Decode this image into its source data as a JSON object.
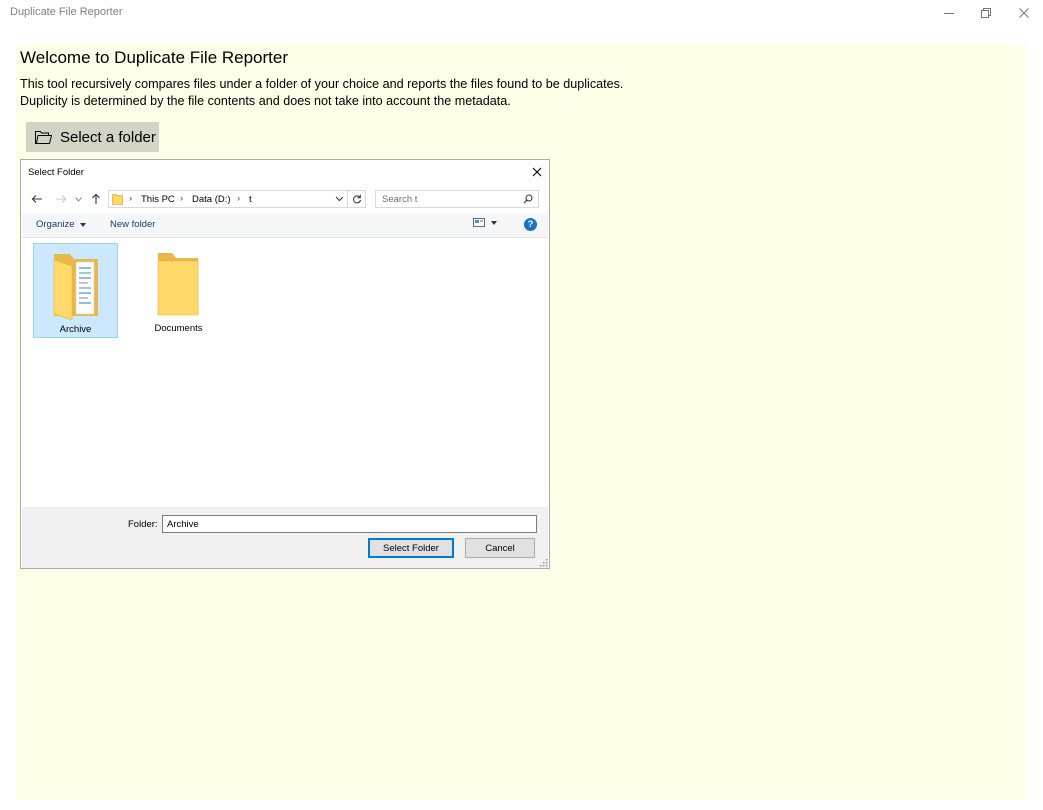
{
  "window": {
    "title": "Duplicate File Reporter"
  },
  "main": {
    "heading": "Welcome to Duplicate File Reporter",
    "description_line1": "This tool recursively compares files under a folder of your choice and reports the files found to be duplicates.",
    "description_line2": "Duplicity is determined by the file contents and does not take into account the metadata.",
    "select_button": "Select a folder"
  },
  "dialog": {
    "title": "Select Folder",
    "breadcrumbs": [
      "This PC",
      "Data (D:)",
      "t"
    ],
    "search_placeholder": "Search t",
    "organize_label": "Organize",
    "new_folder_label": "New folder",
    "help_label": "?",
    "items": [
      {
        "name": "Archive",
        "selected": true
      },
      {
        "name": "Documents",
        "selected": false
      }
    ],
    "folder_field_label": "Folder:",
    "folder_field_value": "Archive",
    "select_button": "Select Folder",
    "cancel_button": "Cancel"
  },
  "colors": {
    "content_background": "#fefee9",
    "select_button_background": "#d4d4c4",
    "selection_highlight": "#cce8ff",
    "accent_blue": "#0078d7"
  }
}
